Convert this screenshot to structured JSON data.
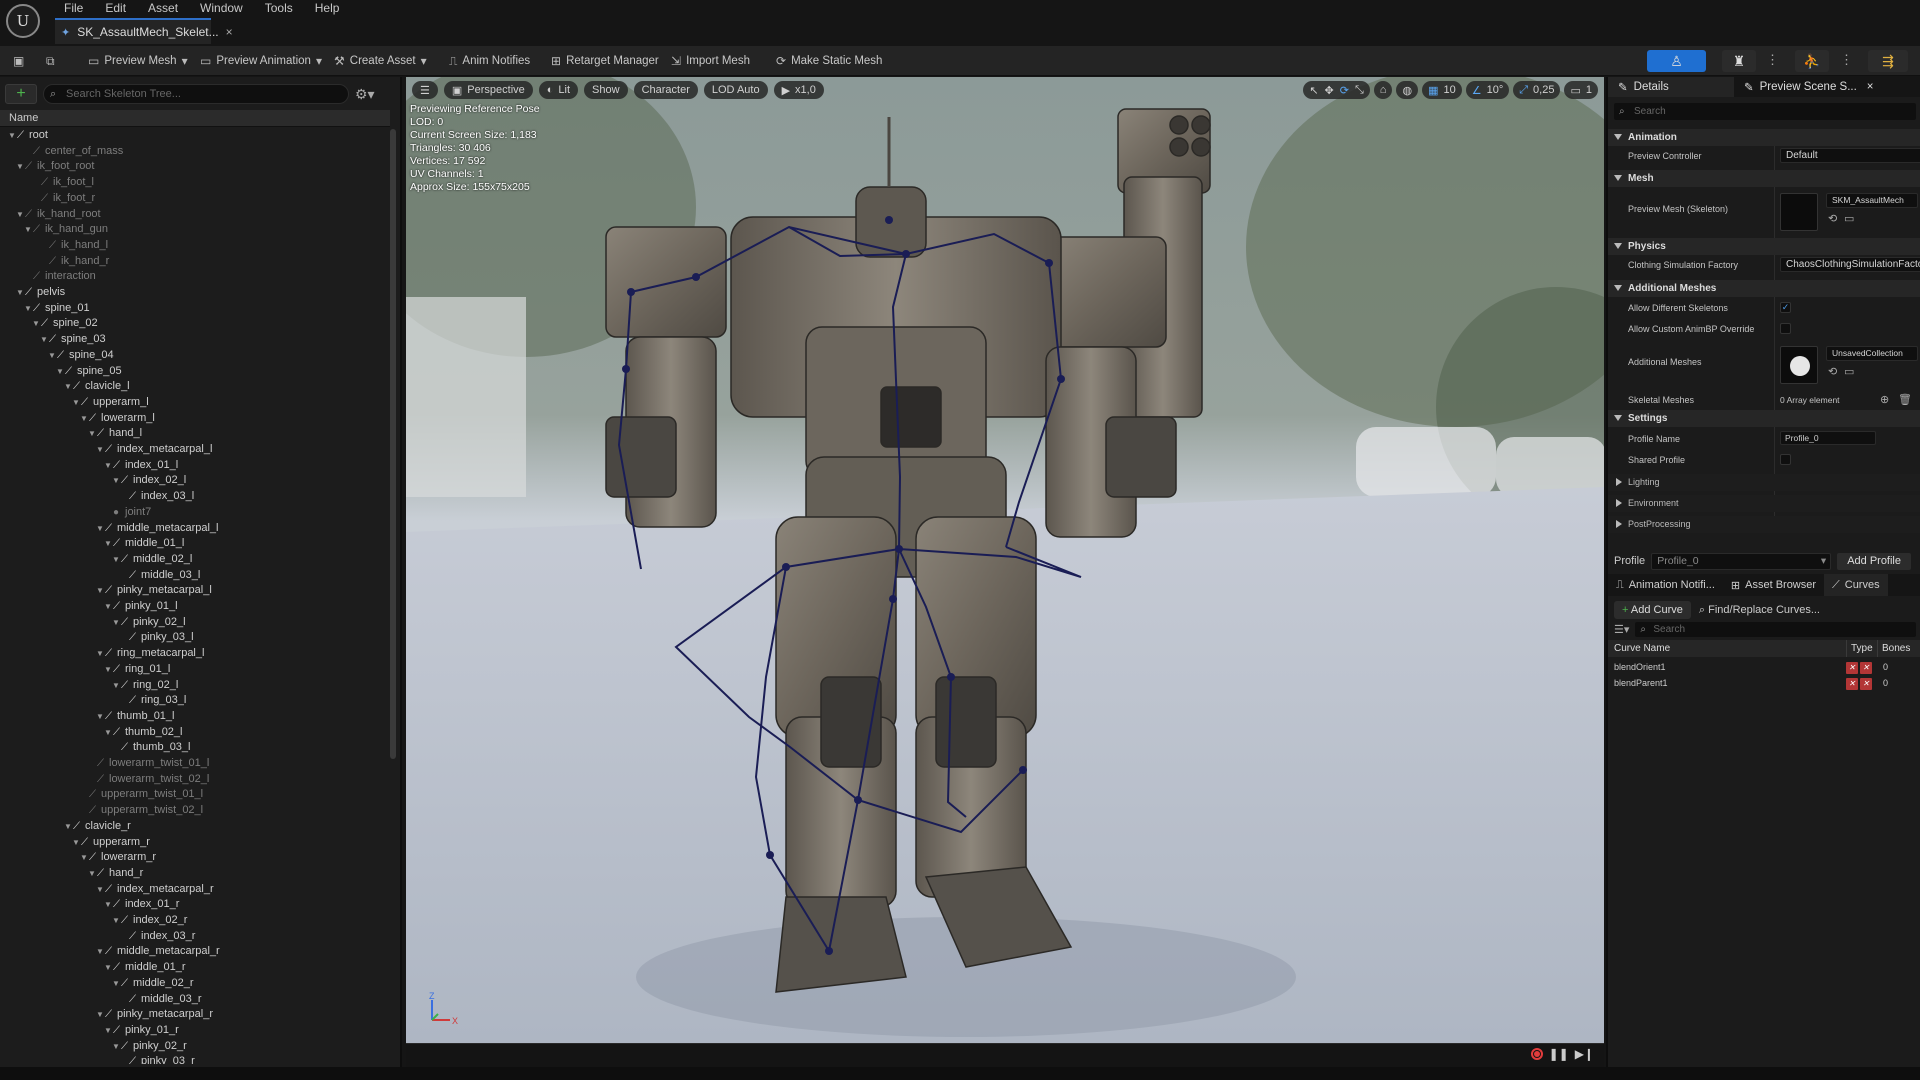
{
  "app": {
    "logo": "U",
    "menus": [
      "File",
      "Edit",
      "Asset",
      "Window",
      "Tools",
      "Help"
    ],
    "tab": "SK_AssaultMech_Skelet..."
  },
  "toolbar": {
    "preview_mesh": "Preview Mesh",
    "preview_animation": "Preview Animation",
    "create_asset": "Create Asset",
    "anim_notifies": "Anim Notifies",
    "retarget_manager": "Retarget Manager",
    "import_mesh": "Import Mesh",
    "make_static_mesh": "Make Static Mesh"
  },
  "skeleton_tree": {
    "search_placeholder": "Search Skeleton Tree...",
    "column": "Name",
    "rows": [
      {
        "label": "root",
        "depth": 0,
        "exp": true,
        "dim": false
      },
      {
        "label": "center_of_mass",
        "depth": 2,
        "exp": false,
        "dim": true
      },
      {
        "label": "ik_foot_root",
        "depth": 1,
        "exp": true,
        "dim": true
      },
      {
        "label": "ik_foot_l",
        "depth": 3,
        "exp": false,
        "dim": true
      },
      {
        "label": "ik_foot_r",
        "depth": 3,
        "exp": false,
        "dim": true
      },
      {
        "label": "ik_hand_root",
        "depth": 1,
        "exp": true,
        "dim": true
      },
      {
        "label": "ik_hand_gun",
        "depth": 2,
        "exp": true,
        "dim": true
      },
      {
        "label": "ik_hand_l",
        "depth": 4,
        "exp": false,
        "dim": true
      },
      {
        "label": "ik_hand_r",
        "depth": 4,
        "exp": false,
        "dim": true
      },
      {
        "label": "interaction",
        "depth": 2,
        "exp": false,
        "dim": true
      },
      {
        "label": "pelvis",
        "depth": 1,
        "exp": true,
        "dim": false
      },
      {
        "label": "spine_01",
        "depth": 2,
        "exp": true,
        "dim": false
      },
      {
        "label": "spine_02",
        "depth": 3,
        "exp": true,
        "dim": false
      },
      {
        "label": "spine_03",
        "depth": 4,
        "exp": true,
        "dim": false
      },
      {
        "label": "spine_04",
        "depth": 5,
        "exp": true,
        "dim": false
      },
      {
        "label": "spine_05",
        "depth": 6,
        "exp": true,
        "dim": false
      },
      {
        "label": "clavicle_l",
        "depth": 7,
        "exp": true,
        "dim": false
      },
      {
        "label": "upperarm_l",
        "depth": 8,
        "exp": true,
        "dim": false
      },
      {
        "label": "lowerarm_l",
        "depth": 9,
        "exp": true,
        "dim": false
      },
      {
        "label": "hand_l",
        "depth": 10,
        "exp": true,
        "dim": false
      },
      {
        "label": "index_metacarpal_l",
        "depth": 11,
        "exp": true,
        "dim": false
      },
      {
        "label": "index_01_l",
        "depth": 12,
        "exp": true,
        "dim": false
      },
      {
        "label": "index_02_l",
        "depth": 13,
        "exp": true,
        "dim": false
      },
      {
        "label": "index_03_l",
        "depth": 14,
        "exp": false,
        "dim": false
      },
      {
        "label": "joint7",
        "depth": 12,
        "exp": false,
        "dim": true
      },
      {
        "label": "middle_metacarpal_l",
        "depth": 11,
        "exp": true,
        "dim": false
      },
      {
        "label": "middle_01_l",
        "depth": 12,
        "exp": true,
        "dim": false
      },
      {
        "label": "middle_02_l",
        "depth": 13,
        "exp": true,
        "dim": false
      },
      {
        "label": "middle_03_l",
        "depth": 14,
        "exp": false,
        "dim": false
      },
      {
        "label": "pinky_metacarpal_l",
        "depth": 11,
        "exp": true,
        "dim": false
      },
      {
        "label": "pinky_01_l",
        "depth": 12,
        "exp": true,
        "dim": false
      },
      {
        "label": "pinky_02_l",
        "depth": 13,
        "exp": true,
        "dim": false
      },
      {
        "label": "pinky_03_l",
        "depth": 14,
        "exp": false,
        "dim": false
      },
      {
        "label": "ring_metacarpal_l",
        "depth": 11,
        "exp": true,
        "dim": false
      },
      {
        "label": "ring_01_l",
        "depth": 12,
        "exp": true,
        "dim": false
      },
      {
        "label": "ring_02_l",
        "depth": 13,
        "exp": true,
        "dim": false
      },
      {
        "label": "ring_03_l",
        "depth": 14,
        "exp": false,
        "dim": false
      },
      {
        "label": "thumb_01_l",
        "depth": 11,
        "exp": true,
        "dim": false
      },
      {
        "label": "thumb_02_l",
        "depth": 12,
        "exp": true,
        "dim": false
      },
      {
        "label": "thumb_03_l",
        "depth": 13,
        "exp": false,
        "dim": false
      },
      {
        "label": "lowerarm_twist_01_l",
        "depth": 10,
        "exp": false,
        "dim": true
      },
      {
        "label": "lowerarm_twist_02_l",
        "depth": 10,
        "exp": false,
        "dim": true
      },
      {
        "label": "upperarm_twist_01_l",
        "depth": 9,
        "exp": false,
        "dim": true
      },
      {
        "label": "upperarm_twist_02_l",
        "depth": 9,
        "exp": false,
        "dim": true
      },
      {
        "label": "clavicle_r",
        "depth": 7,
        "exp": true,
        "dim": false
      },
      {
        "label": "upperarm_r",
        "depth": 8,
        "exp": true,
        "dim": false
      },
      {
        "label": "lowerarm_r",
        "depth": 9,
        "exp": true,
        "dim": false
      },
      {
        "label": "hand_r",
        "depth": 10,
        "exp": true,
        "dim": false
      },
      {
        "label": "index_metacarpal_r",
        "depth": 11,
        "exp": true,
        "dim": false
      },
      {
        "label": "index_01_r",
        "depth": 12,
        "exp": true,
        "dim": false
      },
      {
        "label": "index_02_r",
        "depth": 13,
        "exp": true,
        "dim": false
      },
      {
        "label": "index_03_r",
        "depth": 14,
        "exp": false,
        "dim": false
      },
      {
        "label": "middle_metacarpal_r",
        "depth": 11,
        "exp": true,
        "dim": false
      },
      {
        "label": "middle_01_r",
        "depth": 12,
        "exp": true,
        "dim": false
      },
      {
        "label": "middle_02_r",
        "depth": 13,
        "exp": true,
        "dim": false
      },
      {
        "label": "middle_03_r",
        "depth": 14,
        "exp": false,
        "dim": false
      },
      {
        "label": "pinky_metacarpal_r",
        "depth": 11,
        "exp": true,
        "dim": false
      },
      {
        "label": "pinky_01_r",
        "depth": 12,
        "exp": true,
        "dim": false
      },
      {
        "label": "pinky_02_r",
        "depth": 13,
        "exp": true,
        "dim": false
      },
      {
        "label": "pinky_03_r",
        "depth": 14,
        "exp": false,
        "dim": false
      }
    ]
  },
  "viewport": {
    "perspective": "Perspective",
    "lit": "Lit",
    "show": "Show",
    "character": "Character",
    "lod": "LOD Auto",
    "speed": "x1,0",
    "grid_snap": "10",
    "rot_snap": "10°",
    "scale_snap": "0,25",
    "cam_speed": "1",
    "stats": [
      "Previewing Reference Pose",
      "LOD: 0",
      "Current Screen Size: 1,183",
      "Triangles: 30 406",
      "Vertices: 17 592",
      "UV Channels: 1",
      "Approx Size: 155x75x205"
    ],
    "axis_z": "Z",
    "axis_x": "X"
  },
  "details": {
    "tab_details": "Details",
    "tab_preview": "Preview Scene S...",
    "search_placeholder": "Search",
    "sec_animation": "Animation",
    "preview_controller_label": "Preview Controller",
    "preview_controller_value": "Default",
    "sec_mesh": "Mesh",
    "preview_mesh_label": "Preview Mesh (Skeleton)",
    "preview_mesh_value": "SKM_AssaultMech",
    "sec_physics": "Physics",
    "clothing_label": "Clothing Simulation Factory",
    "clothing_value": "ChaosClothingSimulationFactory",
    "sec_additional": "Additional Meshes",
    "allow_diff_label": "Allow Different Skeletons",
    "allow_custom_label": "Allow Custom AnimBP Override",
    "additional_meshes_label": "Additional Meshes",
    "additional_value": "UnsavedCollection",
    "skeletal_meshes_label": "Skeletal Meshes",
    "skeletal_meshes_value": "0 Array element",
    "sec_settings": "Settings",
    "profile_name_label": "Profile Name",
    "profile_name_value": "Profile_0",
    "shared_profile_label": "Shared Profile",
    "lighting": "Lighting",
    "environment": "Environment",
    "postprocessing": "PostProcessing",
    "allow_diff_checked": true,
    "allow_custom_checked": false,
    "shared_checked": false
  },
  "profile": {
    "label": "Profile",
    "value": "Profile_0",
    "add": "Add Profile"
  },
  "bottom_tabs": {
    "anim_notifies": "Animation Notifi...",
    "asset_browser": "Asset Browser",
    "curves": "Curves"
  },
  "curves": {
    "add": "Add Curve",
    "find_replace": "Find/Replace Curves...",
    "search_placeholder": "Search",
    "col_name": "Curve Name",
    "col_type": "Type",
    "col_bones": "Bones",
    "rows": [
      {
        "name": "blendOrient1",
        "bones": "0"
      },
      {
        "name": "blendParent1",
        "bones": "0"
      }
    ]
  },
  "colors": {
    "accent": "#2f7fe0",
    "active_tab": "#1f6fd1",
    "add_green": "#4db34d",
    "record_red": "#e23c3c",
    "bone": "#1a1d55"
  }
}
